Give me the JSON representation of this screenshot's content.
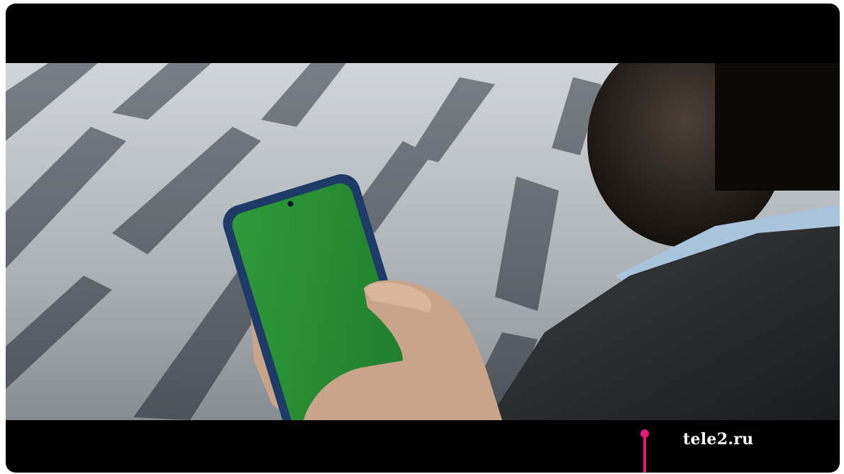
{
  "video": {
    "brand_url": "tele2.ru",
    "brand_color": "#e6187c",
    "letterbox_color": "#000000"
  },
  "scene": {
    "phone_screen_color": "#2a8a35",
    "phone_case_color": "#1e3a66"
  }
}
